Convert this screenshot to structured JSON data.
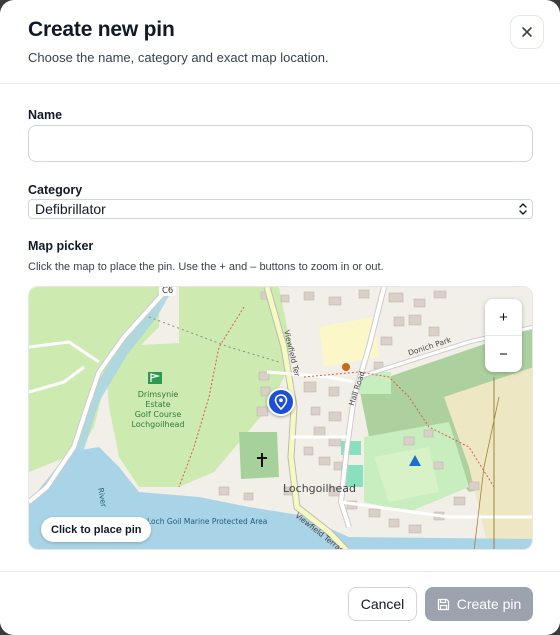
{
  "dialog": {
    "title": "Create new pin",
    "subtitle": "Choose the name, category and exact map location.",
    "close_icon": "close-icon"
  },
  "form": {
    "name_label": "Name",
    "name_value": "",
    "name_placeholder": "",
    "category_label": "Category",
    "category_value": "Defibrillator",
    "map_label": "Map picker",
    "map_hint": "Click the map to place the pin. Use the + and – buttons to zoom in or out."
  },
  "map": {
    "zoom_in": "+",
    "zoom_out": "−",
    "place_chip": "Click to place pin",
    "labels": {
      "road_c6": "C6",
      "golf_1": "Drimsynie",
      "golf_2": "Estate",
      "golf_3": "Golf Course",
      "golf_4": "Lochgoilhead",
      "viewfield_terrace": "Viewfield Ter",
      "hall_road": "Hall Road",
      "donich_park": "Donich Park",
      "village": "Lochgoilhead",
      "viewfield_terrace_2": "Viewfield Terrace",
      "mpa": "Loch Goil Marine Protected Area",
      "river": "River"
    },
    "pin_icon": "map-pin-icon"
  },
  "footer": {
    "cancel_label": "Cancel",
    "create_label": "Create pin",
    "create_icon": "save-icon"
  },
  "colors": {
    "primary_disabled": "#9ca3af",
    "pin_blue": "#1d4ed8",
    "water": "#a9d3e6",
    "park": "#cdebb0",
    "forest": "#add19e",
    "road": "#f7fabf"
  }
}
